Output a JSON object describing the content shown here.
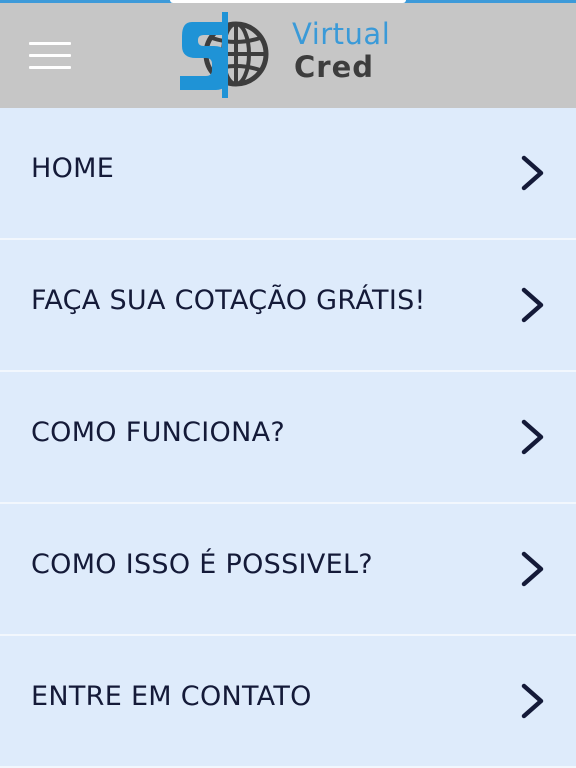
{
  "header": {
    "menu_icon": "hamburger-menu-icon",
    "logo": {
      "word_1": "Virtual",
      "word_2": "Cred",
      "colors": {
        "blue": "#1f93d6",
        "dark": "#3d3d3d"
      }
    },
    "colors": {
      "background": "#c6c6c6",
      "accent": "#3d9ad9"
    }
  },
  "menu": {
    "items": [
      {
        "label": "HOME",
        "icon": "chevron-right-icon"
      },
      {
        "label": "FAÇA SUA COTAÇÃO GRÁTIS!",
        "icon": "chevron-right-icon"
      },
      {
        "label": "COMO FUNCIONA?",
        "icon": "chevron-right-icon"
      },
      {
        "label": "COMO ISSO É POSSIVEL?",
        "icon": "chevron-right-icon"
      },
      {
        "label": "ENTRE EM CONTATO",
        "icon": "chevron-right-icon"
      }
    ],
    "colors": {
      "background": "#deebfb",
      "text": "#141a38",
      "chevron": "#141a38",
      "divider": "#f2f7fd"
    }
  }
}
